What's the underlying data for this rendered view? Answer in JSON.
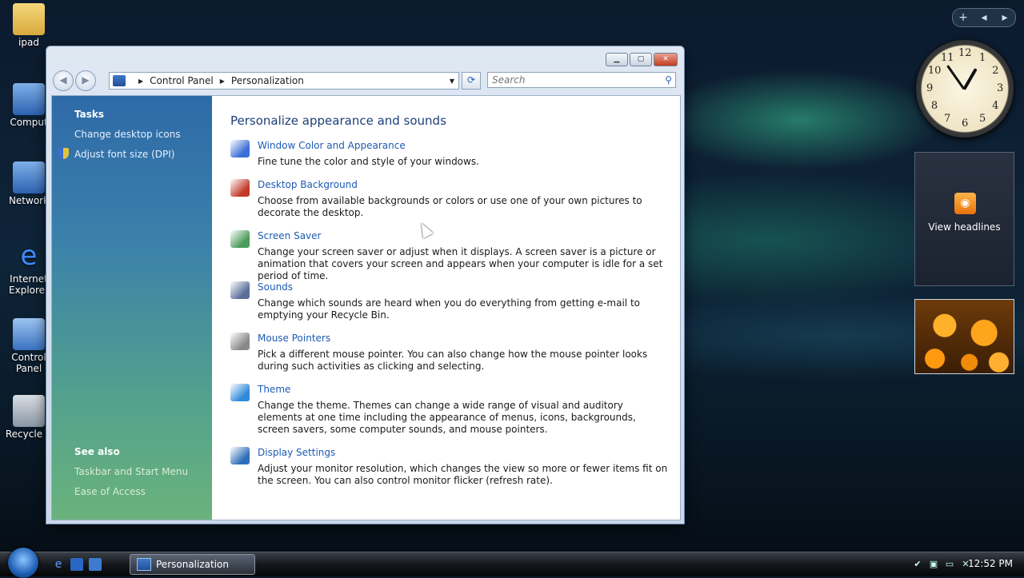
{
  "desktop": {
    "icons": [
      {
        "label": "ipad"
      },
      {
        "label": "Comput"
      },
      {
        "label": "Network"
      },
      {
        "label": "Internet\nExplorer"
      },
      {
        "label": "Control\nPanel"
      },
      {
        "label": "Recycle B"
      }
    ]
  },
  "window": {
    "address": {
      "root": "Control Panel",
      "current": "Personalization"
    },
    "search_placeholder": "Search"
  },
  "sidebar": {
    "tasks_heading": "Tasks",
    "tasks": [
      "Change desktop icons",
      "Adjust font size (DPI)"
    ],
    "see_also_heading": "See also",
    "see_also": [
      "Taskbar and Start Menu",
      "Ease of Access"
    ]
  },
  "content": {
    "heading": "Personalize appearance and sounds",
    "items": [
      {
        "title": "Window Color and Appearance",
        "desc": "Fine tune the color and style of your windows.",
        "icon": "window-color-icon",
        "color": "#3b6fd6"
      },
      {
        "title": "Desktop Background",
        "desc": "Choose from available backgrounds or colors or use one of your own pictures to decorate the desktop.",
        "icon": "desktop-background-icon",
        "color": "#c23a2a"
      },
      {
        "title": "Screen Saver",
        "desc": "Change your screen saver or adjust when it displays. A screen saver is a picture or animation that covers your screen and appears when your computer is idle for a set period of time.",
        "icon": "screen-saver-icon",
        "color": "#4a9a5a"
      },
      {
        "title": "Sounds",
        "desc": "Change which sounds are heard when you do everything from getting e-mail to emptying your Recycle Bin.",
        "icon": "sounds-icon",
        "color": "#5a6f9a"
      },
      {
        "title": "Mouse Pointers",
        "desc": "Pick a different mouse pointer. You can also change how the mouse pointer looks during such activities as clicking and selecting.",
        "icon": "mouse-pointers-icon",
        "color": "#8a8a8a"
      },
      {
        "title": "Theme",
        "desc": "Change the theme. Themes can change a wide range of visual and auditory elements at one time including the appearance of menus, icons, backgrounds, screen savers, some computer sounds, and mouse pointers.",
        "icon": "theme-icon",
        "color": "#2f8ad8"
      },
      {
        "title": "Display Settings",
        "desc": "Adjust your monitor resolution, which changes the view so more or fewer items fit on the screen. You can also control monitor flicker (refresh rate).",
        "icon": "display-settings-icon",
        "color": "#2f6fb8"
      }
    ]
  },
  "gadgets": {
    "clock_numbers": [
      "12",
      "1",
      "2",
      "3",
      "4",
      "5",
      "6",
      "7",
      "8",
      "9",
      "10",
      "11"
    ],
    "feed_label": "View headlines"
  },
  "taskbar": {
    "active_task": "Personalization",
    "time": "12:52 PM"
  }
}
